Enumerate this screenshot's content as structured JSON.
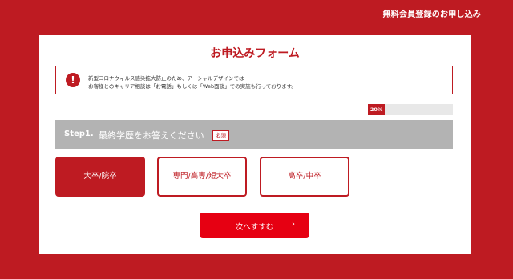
{
  "header": {
    "register_link": "無料会員登録のお申し込み"
  },
  "form": {
    "title": "お申込みフォーム",
    "notice": {
      "icon": "exclamation-circle-icon",
      "line1": "新型コロナウィルス感染拡大防止のため、アーシャルデザインでは",
      "line2": "お客様とのキャリア相談は「お電話」もしくは「Web面談」での実施も行っております。"
    },
    "progress": {
      "percent": 20,
      "label": "20%"
    },
    "step": {
      "label": "Step1.",
      "question": "最終学歴をお答えください",
      "required": "必須"
    },
    "options": [
      {
        "label": "大卒/院卒",
        "selected": true
      },
      {
        "label": "専門/高専/短大卒",
        "selected": false
      },
      {
        "label": "高卒/中卒",
        "selected": false
      }
    ],
    "next_button": {
      "label": "次へすすむ",
      "icon": "chevron-right-icon",
      "icon_glyph": "›"
    }
  },
  "colors": {
    "brand": "#be1b22",
    "button": "#e60012",
    "step_bar": "#b3b3b3"
  }
}
